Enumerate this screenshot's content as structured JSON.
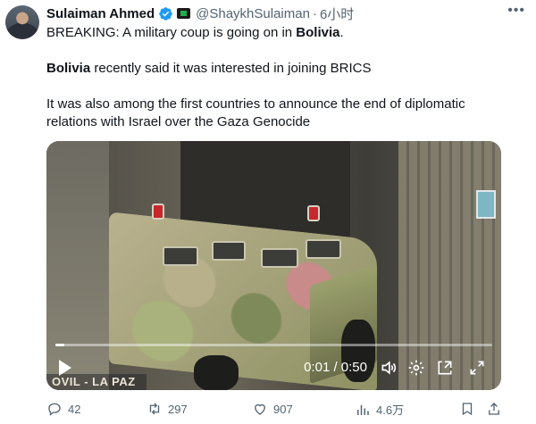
{
  "author": {
    "name": "Sulaiman Ahmed",
    "handle": "@ShaykhSulaiman",
    "separator": "·",
    "time": "6小时"
  },
  "tweet": {
    "line1_pre": "BREAKING: A military coup is going on in ",
    "line1_bold": "Bolivia",
    "line1_post": ".",
    "line2_bold": "Bolivia",
    "line2_post": " recently said it was interested in joining BRICS",
    "line3": "It was also among the first countries to announce the end of diplomatic",
    "line4": "relations with Israel over the Gaza Genocide"
  },
  "video": {
    "watermark": "OVIL - LA PAZ",
    "timecode": "0:01 / 0:50",
    "progress": 0.02
  },
  "actions": {
    "replies": "42",
    "retweets": "297",
    "likes": "907",
    "views": "4.6万"
  },
  "colors": {
    "text": "#0f1419",
    "secondary": "#536471",
    "verified": "#1d9bf0"
  },
  "icons": [
    "more-icon",
    "verified-icon",
    "play-icon",
    "volume-icon",
    "settings-icon",
    "pip-icon",
    "fullscreen-icon",
    "reply-icon",
    "retweet-icon",
    "like-icon",
    "views-icon",
    "bookmark-icon",
    "share-icon"
  ]
}
